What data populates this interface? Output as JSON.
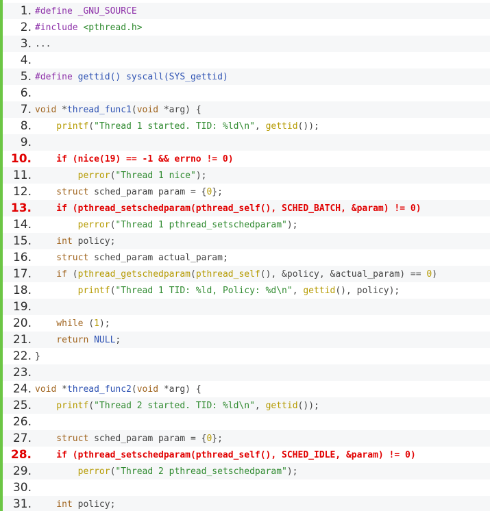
{
  "accent_bar_color": "#6cc644",
  "highlight_color": "#e10000",
  "lines": [
    {
      "num": "1.",
      "hl": false,
      "tokens": [
        {
          "t": "#define _GNU_SOURCE",
          "c": "pre"
        }
      ]
    },
    {
      "num": "2.",
      "hl": false,
      "tokens": [
        {
          "t": "#include ",
          "c": "pre"
        },
        {
          "t": "<pthread.h>",
          "c": "str"
        }
      ]
    },
    {
      "num": "3.",
      "hl": false,
      "tokens": [
        {
          "t": "...",
          "c": "plain"
        }
      ]
    },
    {
      "num": "4.",
      "hl": false,
      "tokens": []
    },
    {
      "num": "5.",
      "hl": false,
      "tokens": [
        {
          "t": "#define ",
          "c": "pre"
        },
        {
          "t": "gettid() syscall(SYS_gettid)",
          "c": "fn"
        }
      ]
    },
    {
      "num": "6.",
      "hl": false,
      "tokens": []
    },
    {
      "num": "7.",
      "hl": false,
      "tokens": [
        {
          "t": "void",
          "c": "kw"
        },
        {
          "t": " *",
          "c": "plain"
        },
        {
          "t": "thread_func1",
          "c": "fn"
        },
        {
          "t": "(",
          "c": "plain"
        },
        {
          "t": "void",
          "c": "kw"
        },
        {
          "t": " *arg) {",
          "c": "plain"
        }
      ]
    },
    {
      "num": "8.",
      "hl": false,
      "tokens": [
        {
          "t": "    printf",
          "c": "ye"
        },
        {
          "t": "(",
          "c": "plain"
        },
        {
          "t": "\"Thread 1 started. TID: %ld\\n\"",
          "c": "str"
        },
        {
          "t": ", ",
          "c": "plain"
        },
        {
          "t": "gettid",
          "c": "ye"
        },
        {
          "t": "());",
          "c": "plain"
        }
      ]
    },
    {
      "num": "9.",
      "hl": false,
      "tokens": []
    },
    {
      "num": "10.",
      "hl": true,
      "tokens": [
        {
          "t": "    if (nice(19) == -1 && errno != 0)",
          "c": "plain"
        }
      ]
    },
    {
      "num": "11.",
      "hl": false,
      "tokens": [
        {
          "t": "        perror",
          "c": "ye"
        },
        {
          "t": "(",
          "c": "plain"
        },
        {
          "t": "\"Thread 1 nice\"",
          "c": "str"
        },
        {
          "t": ");",
          "c": "plain"
        }
      ]
    },
    {
      "num": "12.",
      "hl": false,
      "tokens": [
        {
          "t": "    struct",
          "c": "kw"
        },
        {
          "t": " sched_param param = {",
          "c": "plain"
        },
        {
          "t": "0",
          "c": "ye"
        },
        {
          "t": "};",
          "c": "plain"
        }
      ]
    },
    {
      "num": "13.",
      "hl": true,
      "tokens": [
        {
          "t": "    if (pthread_setschedparam(pthread_self(), SCHED_BATCH, &param) != 0)",
          "c": "plain"
        }
      ]
    },
    {
      "num": "14.",
      "hl": false,
      "tokens": [
        {
          "t": "        perror",
          "c": "ye"
        },
        {
          "t": "(",
          "c": "plain"
        },
        {
          "t": "\"Thread 1 pthread_setschedparam\"",
          "c": "str"
        },
        {
          "t": ");",
          "c": "plain"
        }
      ]
    },
    {
      "num": "15.",
      "hl": false,
      "tokens": [
        {
          "t": "    int",
          "c": "kw"
        },
        {
          "t": " policy;",
          "c": "plain"
        }
      ]
    },
    {
      "num": "16.",
      "hl": false,
      "tokens": [
        {
          "t": "    struct",
          "c": "kw"
        },
        {
          "t": " sched_param actual_param;",
          "c": "plain"
        }
      ]
    },
    {
      "num": "17.",
      "hl": false,
      "tokens": [
        {
          "t": "    if",
          "c": "kw"
        },
        {
          "t": " (",
          "c": "plain"
        },
        {
          "t": "pthread_getschedparam",
          "c": "ye"
        },
        {
          "t": "(",
          "c": "plain"
        },
        {
          "t": "pthread_self",
          "c": "ye"
        },
        {
          "t": "(), &policy, &actual_param) == ",
          "c": "plain"
        },
        {
          "t": "0",
          "c": "ye"
        },
        {
          "t": ")",
          "c": "plain"
        }
      ]
    },
    {
      "num": "18.",
      "hl": false,
      "tokens": [
        {
          "t": "        printf",
          "c": "ye"
        },
        {
          "t": "(",
          "c": "plain"
        },
        {
          "t": "\"Thread 1 TID: %ld, Policy: %d\\n\"",
          "c": "str"
        },
        {
          "t": ", ",
          "c": "plain"
        },
        {
          "t": "gettid",
          "c": "ye"
        },
        {
          "t": "(), policy);",
          "c": "plain"
        }
      ]
    },
    {
      "num": "19.",
      "hl": false,
      "tokens": []
    },
    {
      "num": "20.",
      "hl": false,
      "tokens": [
        {
          "t": "    while",
          "c": "kw"
        },
        {
          "t": " (",
          "c": "plain"
        },
        {
          "t": "1",
          "c": "ye"
        },
        {
          "t": ");",
          "c": "plain"
        }
      ]
    },
    {
      "num": "21.",
      "hl": false,
      "tokens": [
        {
          "t": "    return",
          "c": "kw"
        },
        {
          "t": " ",
          "c": "plain"
        },
        {
          "t": "NULL",
          "c": "fn"
        },
        {
          "t": ";",
          "c": "plain"
        }
      ]
    },
    {
      "num": "22.",
      "hl": false,
      "tokens": [
        {
          "t": "}",
          "c": "plain"
        }
      ]
    },
    {
      "num": "23.",
      "hl": false,
      "tokens": []
    },
    {
      "num": "24.",
      "hl": false,
      "tokens": [
        {
          "t": "void",
          "c": "kw"
        },
        {
          "t": " *",
          "c": "plain"
        },
        {
          "t": "thread_func2",
          "c": "fn"
        },
        {
          "t": "(",
          "c": "plain"
        },
        {
          "t": "void",
          "c": "kw"
        },
        {
          "t": " *arg) {",
          "c": "plain"
        }
      ]
    },
    {
      "num": "25.",
      "hl": false,
      "tokens": [
        {
          "t": "    printf",
          "c": "ye"
        },
        {
          "t": "(",
          "c": "plain"
        },
        {
          "t": "\"Thread 2 started. TID: %ld\\n\"",
          "c": "str"
        },
        {
          "t": ", ",
          "c": "plain"
        },
        {
          "t": "gettid",
          "c": "ye"
        },
        {
          "t": "());",
          "c": "plain"
        }
      ]
    },
    {
      "num": "26.",
      "hl": false,
      "tokens": []
    },
    {
      "num": "27.",
      "hl": false,
      "tokens": [
        {
          "t": "    struct",
          "c": "kw"
        },
        {
          "t": " sched_param param = {",
          "c": "plain"
        },
        {
          "t": "0",
          "c": "ye"
        },
        {
          "t": "};",
          "c": "plain"
        }
      ]
    },
    {
      "num": "28.",
      "hl": true,
      "tokens": [
        {
          "t": "    if (pthread_setschedparam(pthread_self(), SCHED_IDLE, &param) != 0)",
          "c": "plain"
        }
      ]
    },
    {
      "num": "29.",
      "hl": false,
      "tokens": [
        {
          "t": "        perror",
          "c": "ye"
        },
        {
          "t": "(",
          "c": "plain"
        },
        {
          "t": "\"Thread 2 pthread_setschedparam\"",
          "c": "str"
        },
        {
          "t": ");",
          "c": "plain"
        }
      ]
    },
    {
      "num": "30.",
      "hl": false,
      "tokens": []
    },
    {
      "num": "31.",
      "hl": false,
      "tokens": [
        {
          "t": "    int",
          "c": "kw"
        },
        {
          "t": " policy;",
          "c": "plain"
        }
      ]
    }
  ]
}
